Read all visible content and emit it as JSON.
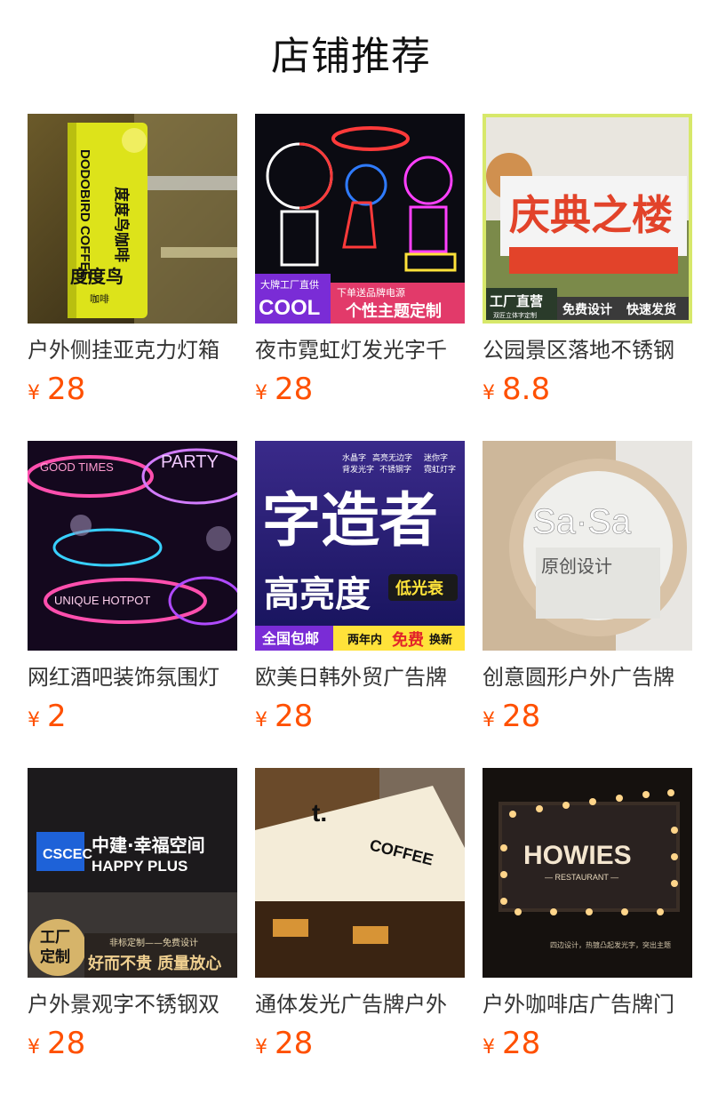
{
  "header": {
    "title": "店铺推荐"
  },
  "currency_symbol": "¥",
  "products": [
    {
      "name": "户外侧挂亚克力灯箱",
      "price": "28",
      "image_texts": [
        "DODOBIRD COFFEE",
        "度度鸟咖啡",
        "度度鸟",
        "咖啡"
      ]
    },
    {
      "name": "夜市霓虹灯发光字千",
      "price": "28",
      "image_texts": [
        "大牌工厂直供",
        "COOL",
        "下单送品牌电源",
        "个性主题定制"
      ]
    },
    {
      "name": "公园景区落地不锈钢",
      "price": "8.8",
      "image_texts": [
        "庆典之楼",
        "工厂直营",
        "双匠立体字定制",
        "免费设计",
        "快速发货"
      ]
    },
    {
      "name": "网红酒吧装饰氛围灯",
      "price": "2",
      "image_texts": [
        "GOOD TIMES",
        "PARTY",
        "UNIQUE HOTPOT"
      ]
    },
    {
      "name": "欧美日韩外贸广告牌",
      "price": "28",
      "image_texts": [
        "水晶字",
        "高亮无边字",
        "迷你字",
        "背发光字",
        "不锈钢字",
        "霓虹灯字",
        "字造者",
        "高亮度",
        "低光衰",
        "全国包邮",
        "两年内",
        "免费",
        "换新"
      ]
    },
    {
      "name": "创意圆形户外广告牌",
      "price": "28",
      "image_texts": [
        "Sa·Sa",
        "原创设计"
      ]
    },
    {
      "name": "户外景观字不锈钢双",
      "price": "28",
      "image_texts": [
        "中建·幸福空间",
        "HAPPY PLUS",
        "工厂",
        "定制",
        "非标定制——免费设计",
        "好而不贵 质量放心"
      ]
    },
    {
      "name": "通体发光广告牌户外",
      "price": "28",
      "image_texts": [
        "t.",
        "COFFEE"
      ]
    },
    {
      "name": "户外咖啡店广告牌门",
      "price": "28",
      "image_texts": [
        "HOWIES",
        "— RESTAURANT —",
        "四边设计，热镀凸起发光字，突出主题"
      ]
    }
  ]
}
